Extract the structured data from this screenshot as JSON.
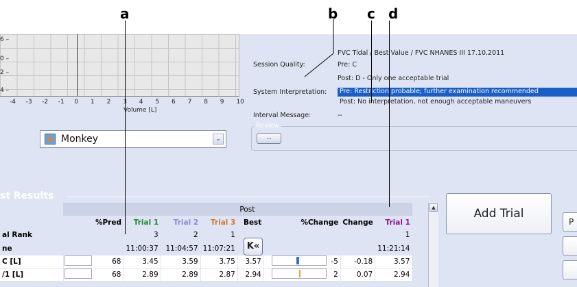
{
  "callouts": {
    "a": "a",
    "b": "b",
    "c": "c",
    "d": "d"
  },
  "graph": {
    "y_ticks": [
      "6 –",
      "0 –",
      "2 –",
      "4 –"
    ],
    "x_ticks": [
      "-4",
      "-3",
      "-2",
      "-1",
      "0",
      "1",
      "2",
      "3",
      "4",
      "5",
      "6",
      "7",
      "8",
      "9",
      "10"
    ],
    "x_label": "Volume [L]"
  },
  "patient_combo": {
    "value": "Monkey",
    "dropdown_glyph": "⌄"
  },
  "session": {
    "quality_label": "Session Quality:",
    "quality_header": "FVC Tidal / Best Value / FVC     NHANES III     17.10.2011",
    "pre_quality": "Pre:  C",
    "post_quality": "Post:  D - Only one acceptable trial",
    "interp_label": "System Interpretation:",
    "pre_interp": "Pre: Restriction probable; further examination recommended",
    "post_interp": "Post:  No interpretation, not enough acceptable maneuvers",
    "interval_label": "Interval Message:",
    "interval_value": "--",
    "review_legend": "Review",
    "review_button": "..."
  },
  "results": {
    "section_title": "st Results",
    "post_header": "Post",
    "columns": [
      "",
      "",
      "%Pred",
      "Trial 1",
      "Trial 2",
      "Trial 3",
      "Best",
      "%Change",
      "Change",
      "Trial 1"
    ],
    "column_colors": {
      "trial1": "#1c8a2e",
      "trial2": "#8a8ad8",
      "trial3": "#d07a2a",
      "post_trial1": "#8a1a8a"
    },
    "rows": [
      {
        "name": "al Rank",
        "pred": "",
        "t1": "3",
        "t2": "2",
        "t3": "1",
        "best": "",
        "pchange": "",
        "change": "",
        "post_t1": "1"
      },
      {
        "name": "ne",
        "pred": "",
        "t1": "11:00:37",
        "t2": "11:04:57",
        "t3": "11:07:21",
        "best": "",
        "pchange": "",
        "change": "",
        "post_t1": "11:21:14"
      },
      {
        "name": "C [L]",
        "pred": "68",
        "t1": "3.45",
        "t2": "3.59",
        "t3": "3.75",
        "best": "3.57",
        "pchange": "-5",
        "change": "-0.18",
        "post_t1": "3.57"
      },
      {
        "name": "/1 [L]",
        "pred": "68",
        "t1": "2.89",
        "t2": "2.89",
        "t3": "2.87",
        "best": "2.94",
        "pchange": "2",
        "change": "0.07",
        "post_t1": "2.94"
      }
    ],
    "ff_button": "K«"
  },
  "buttons": {
    "add_trial": "Add Trial",
    "side_p": "P"
  }
}
